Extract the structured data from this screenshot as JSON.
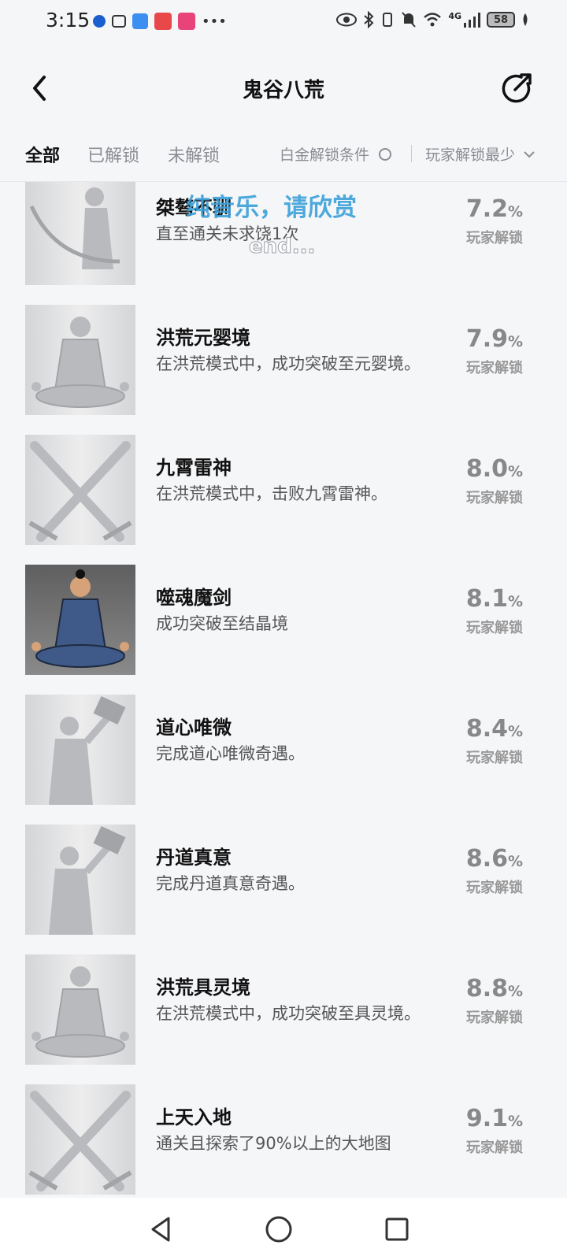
{
  "status_bar": {
    "time": "3:15",
    "network": "4G",
    "battery": "58"
  },
  "header": {
    "title": "鬼谷八荒"
  },
  "filters": {
    "tabs": [
      "全部",
      "已解锁",
      "未解锁"
    ],
    "active_tab": "全部",
    "platinum_condition": "白金解锁条件",
    "sort": "玩家解锁最少"
  },
  "overlay": {
    "caption_main": "纯音乐，请欣赏",
    "caption_sub": "end..."
  },
  "achievements": [
    {
      "name": "桀骜不驯",
      "desc": "直至通关未求饶1次",
      "percent": "7.2",
      "rate_label": "玩家解锁",
      "icon": "swordsman-icon",
      "unlocked": false
    },
    {
      "name": "洪荒元婴境",
      "desc": "在洪荒模式中，成功突破至元婴境。",
      "percent": "7.9",
      "rate_label": "玩家解锁",
      "icon": "meditating-cultivator-icon",
      "unlocked": false
    },
    {
      "name": "九霄雷神",
      "desc": "在洪荒模式中，击败九霄雷神。",
      "percent": "8.0",
      "rate_label": "玩家解锁",
      "icon": "crossed-swords-icon",
      "unlocked": false
    },
    {
      "name": "噬魂魔剑",
      "desc": "成功突破至结晶境",
      "percent": "8.1",
      "rate_label": "玩家解锁",
      "icon": "meditating-cultivator-icon",
      "unlocked": true
    },
    {
      "name": "道心唯微",
      "desc": "完成道心唯微奇遇。",
      "percent": "8.4",
      "rate_label": "玩家解锁",
      "icon": "scholar-scroll-icon",
      "unlocked": false
    },
    {
      "name": "丹道真意",
      "desc": "完成丹道真意奇遇。",
      "percent": "8.6",
      "rate_label": "玩家解锁",
      "icon": "scholar-scroll-icon",
      "unlocked": false
    },
    {
      "name": "洪荒具灵境",
      "desc": "在洪荒模式中，成功突破至具灵境。",
      "percent": "8.8",
      "rate_label": "玩家解锁",
      "icon": "meditating-cultivator-icon",
      "unlocked": false
    },
    {
      "name": "上天入地",
      "desc": "通关且探索了90%以上的大地图",
      "percent": "9.1",
      "rate_label": "玩家解锁",
      "icon": "crossed-swords-icon",
      "unlocked": false
    }
  ],
  "percent_suffix": "%"
}
